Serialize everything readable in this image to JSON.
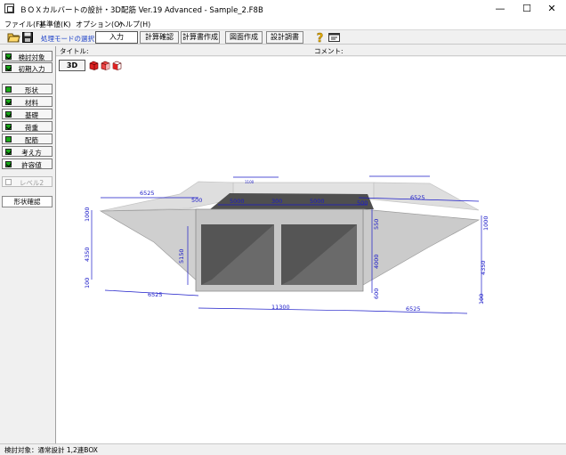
{
  "window": {
    "title": "ＢＯＸカルバートの設計・3D配筋 Ver.19 Advanced - Sample_2.F8B",
    "minimize": "—",
    "maximize": "☐",
    "close": "✕"
  },
  "menu": [
    "ファイル(F)",
    "基準値(K)",
    "オプション(O)",
    "ヘルプ(H)"
  ],
  "toolbar": {
    "mode_label": "処理モードの選択",
    "modes": [
      "入力",
      "計算確認",
      "計算書作成",
      "図面作成",
      "設計調書"
    ]
  },
  "info": {
    "title_label": "タイトル:",
    "comment_label": "コメント:"
  },
  "sidebar": {
    "top": [
      {
        "label": "検討対象",
        "checked": true
      },
      {
        "label": "初期入力",
        "checked": true
      }
    ],
    "main": [
      {
        "label": "形状",
        "checked": false
      },
      {
        "label": "材料",
        "checked": true
      },
      {
        "label": "基礎",
        "checked": true
      },
      {
        "label": "荷重",
        "checked": true
      },
      {
        "label": "配筋",
        "checked": false
      },
      {
        "label": "考え方",
        "checked": true
      },
      {
        "label": "許容値",
        "checked": true
      }
    ],
    "level2": {
      "label": "レベル2",
      "checked": false
    },
    "shape_tab": "形状確認"
  },
  "view": {
    "btn_3d": "3D"
  },
  "drawing": {
    "dims": [
      "6525",
      "500",
      "5000",
      "300",
      "5000",
      "500",
      "6525",
      "1000",
      "4350",
      "100",
      "1100",
      "1000",
      "4350",
      "100",
      "550",
      "5150",
      "4000",
      "600",
      "6525",
      "11300",
      "6525"
    ]
  },
  "colors": {
    "dimension": "#1a1ac8",
    "concrete_light": "#d0d0d0",
    "concrete_dark": "#5a5a5a",
    "accent": "#1a3fc8"
  },
  "status": "検討対象：通常設計 1,2連BOX"
}
